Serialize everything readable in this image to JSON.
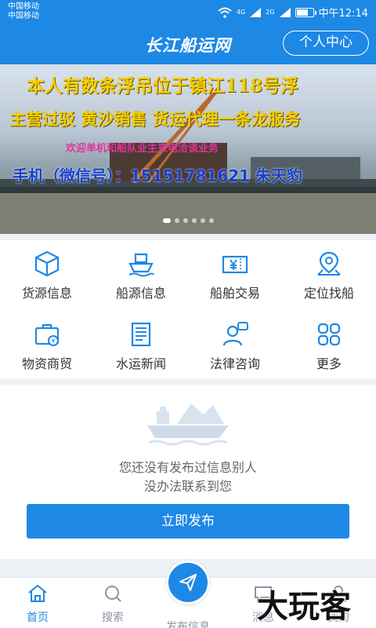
{
  "status_bar": {
    "carrier1": "中国移动",
    "carrier2": "中国移动",
    "net1": "4G",
    "net2": "2G",
    "time": "中午12:14",
    "battery_level": 0.72
  },
  "header": {
    "title": "长江船运网",
    "profile_button": "个人中心"
  },
  "banner": {
    "line1": "本人有数条浮吊位于镇江118号浮",
    "line2": "主营过驳 黄沙销售 货运代理一条龙服务",
    "line3": "欢迎单机和船队业主来电洽谈业务",
    "line4": "手机（微信号）：15151781621    朱天豹",
    "slide_count": 6,
    "active_slide": 1
  },
  "grid": {
    "items": [
      {
        "label": "货源信息",
        "icon": "box-icon"
      },
      {
        "label": "船源信息",
        "icon": "ship-icon"
      },
      {
        "label": "船舶交易",
        "icon": "ticket-icon"
      },
      {
        "label": "定位找船",
        "icon": "location-icon"
      },
      {
        "label": "物资商贸",
        "icon": "briefcase-icon"
      },
      {
        "label": "水运新闻",
        "icon": "newspaper-icon"
      },
      {
        "label": "法律咨询",
        "icon": "consult-icon"
      },
      {
        "label": "更多",
        "icon": "grid-icon"
      }
    ]
  },
  "empty_state": {
    "line1": "您还没有发布过信息别人",
    "line2": "没办法联系到您",
    "button": "立即发布"
  },
  "bottom_nav": {
    "items": [
      {
        "label": "首页",
        "icon": "home-icon",
        "active": true
      },
      {
        "label": "搜索",
        "icon": "search-icon",
        "active": false
      },
      {
        "label": "发布信息",
        "icon": "send-icon",
        "active": false
      },
      {
        "label": "消息",
        "icon": "message-icon",
        "active": false
      },
      {
        "label": "我的",
        "icon": "user-icon",
        "active": false
      }
    ]
  },
  "watermark": "大玩客",
  "colors": {
    "primary": "#1e88e5",
    "banner_yellow": "#f2d000",
    "banner_pink": "#e1349a",
    "banner_blue": "#1640c9"
  }
}
